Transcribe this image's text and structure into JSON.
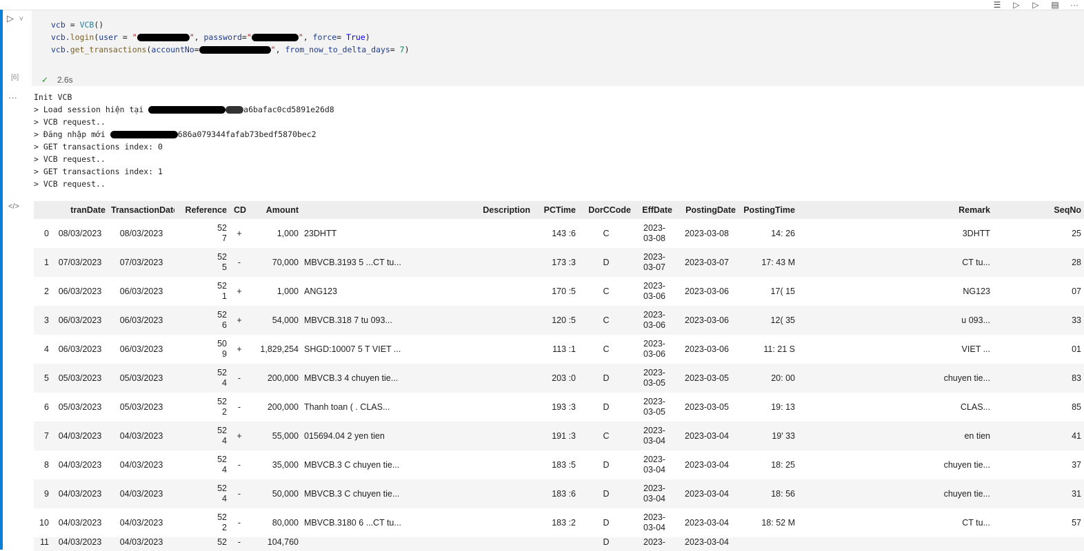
{
  "toolbar": {
    "icons": [
      "run-by-line-icon",
      "execute-above-icon",
      "execute-below-icon",
      "split-cell-icon",
      "more-icon"
    ],
    "more_label": "···"
  },
  "code_cell": {
    "run_glyph": "▷",
    "collapse_glyph": "˅",
    "execution_count": "[6]",
    "status_check": "✓",
    "execution_time": "2.6s",
    "lines": {
      "l1_var": "vcb",
      "l1_op": " = ",
      "l1_cls": "VCB",
      "l1_paren": "()",
      "l2_obj": "vcb.",
      "l2_fn": "login",
      "l2_open": "(",
      "l2_user_kw": "user",
      "l2_eq1": " = ",
      "l2_q1": "\"",
      "l2_q2": "\"",
      "l2_comma1": ", ",
      "l2_pass_kw": "password",
      "l2_eq2": "=",
      "l2_q3": "\"",
      "l2_q4": "\"",
      "l2_comma2": ", ",
      "l2_force_kw": "force",
      "l2_eq3": "= ",
      "l2_true": "True",
      "l2_close": ")",
      "l3_obj": "vcb.",
      "l3_fn": "get_transactions",
      "l3_open": "(",
      "l3_acc_kw": "accountNo",
      "l3_eq1": "=",
      "l3_q1": "\"",
      "l3_comma": ", ",
      "l3_days_kw": "from_now_to_delta_days",
      "l3_eq2": "= ",
      "l3_days": "7",
      "l3_close": ")"
    }
  },
  "output": {
    "more_glyph": "···",
    "html_glyph": "</>",
    "lines": {
      "o1": "Init VCB",
      "o2_pre": "> Load session hiện tại ",
      "o2_post": "a6bafac0cd5891e26d8",
      "o3": "> VCB request..",
      "o4_pre": "> Đăng nhập mới ",
      "o4_post": "686a079344fafab73bedf5870bec2",
      "o5": "> GET transactions index: 0",
      "o6": "> VCB request..",
      "o7": "> GET transactions index: 1",
      "o8": "> VCB request.."
    }
  },
  "table": {
    "columns": [
      "",
      "tranDate",
      "TransactionDate",
      "Reference",
      "CD",
      "Amount",
      "Description",
      "PCTime",
      "DorCCode",
      "EffDate",
      "PostingDate",
      "PostingTime",
      "Remark",
      "SeqNo"
    ],
    "rows": [
      {
        "idx": "0",
        "tranDate": "08/03/2023",
        "transactionDate": "08/03/2023",
        "reference": "52\n7",
        "cd": "+",
        "amount": "1,000",
        "description": "23DHTT",
        "pctime": "143 :6",
        "dorc": "C",
        "effdate": "2023-\n03-08",
        "postingdate": "2023-03-08",
        "postingtime": "14: 26",
        "remark": "3DHTT",
        "seqno": "25"
      },
      {
        "idx": "1",
        "tranDate": "07/03/2023",
        "transactionDate": "07/03/2023",
        "reference": "52\n5",
        "cd": "-",
        "amount": "70,000",
        "description": "MBVCB.3193 5   ...CT tu...",
        "pctime": "173 :3",
        "dorc": "D",
        "effdate": "2023-\n03-07",
        "postingdate": "2023-03-07",
        "postingtime": "17: 43  M",
        "remark": "CT tu...",
        "seqno": "28"
      },
      {
        "idx": "2",
        "tranDate": "06/03/2023",
        "transactionDate": "06/03/2023",
        "reference": "52\n1",
        "cd": "+",
        "amount": "1,000",
        "description": "ANG123",
        "pctime": "170 :5",
        "dorc": "C",
        "effdate": "2023-\n03-06",
        "postingdate": "2023-03-06",
        "postingtime": "17( 15",
        "remark": "NG123",
        "seqno": "07"
      },
      {
        "idx": "3",
        "tranDate": "06/03/2023",
        "transactionDate": "06/03/2023",
        "reference": "52\n6",
        "cd": "+",
        "amount": "54,000",
        "description": "MBVCB.318 7   tu 093...",
        "pctime": "120 :5",
        "dorc": "C",
        "effdate": "2023-\n03-06",
        "postingdate": "2023-03-06",
        "postingtime": "12( 35",
        "remark": "u 093...",
        "seqno": "33"
      },
      {
        "idx": "4",
        "tranDate": "06/03/2023",
        "transactionDate": "06/03/2023",
        "reference": "50\n9",
        "cd": "+",
        "amount": "1,829,254",
        "description": "SHGD:10007 5   T VIET ...",
        "pctime": "113 :1",
        "dorc": "C",
        "effdate": "2023-\n03-06",
        "postingdate": "2023-03-06",
        "postingtime": "11: 21  S",
        "remark": "VIET ...",
        "seqno": "01"
      },
      {
        "idx": "5",
        "tranDate": "05/03/2023",
        "transactionDate": "05/03/2023",
        "reference": "52\n4",
        "cd": "-",
        "amount": "200,000",
        "description": "MBVCB.3 4   chuyen tie...",
        "pctime": "203 :0",
        "dorc": "D",
        "effdate": "2023-\n03-05",
        "postingdate": "2023-03-05",
        "postingtime": "20: 00",
        "remark": "chuyen tie...",
        "seqno": "83"
      },
      {
        "idx": "6",
        "tranDate": "05/03/2023",
        "transactionDate": "05/03/2023",
        "reference": "52\n2",
        "cd": "-",
        "amount": "200,000",
        "description": "Thanh toan (   . CLAS...",
        "pctime": "193 :3",
        "dorc": "D",
        "effdate": "2023-\n03-05",
        "postingdate": "2023-03-05",
        "postingtime": "19: 13",
        "remark": "CLAS...",
        "seqno": "85"
      },
      {
        "idx": "7",
        "tranDate": "04/03/2023",
        "transactionDate": "04/03/2023",
        "reference": "52\n4",
        "cd": "+",
        "amount": "55,000",
        "description": "015694.04 2   yen tien",
        "pctime": "191 :3",
        "dorc": "C",
        "effdate": "2023-\n03-04",
        "postingdate": "2023-03-04",
        "postingtime": "19' 33",
        "remark": "en tien",
        "seqno": "41"
      },
      {
        "idx": "8",
        "tranDate": "04/03/2023",
        "transactionDate": "04/03/2023",
        "reference": "52\n4",
        "cd": "-",
        "amount": "35,000",
        "description": "MBVCB.3 C   chuyen tie...",
        "pctime": "183 :5",
        "dorc": "D",
        "effdate": "2023-\n03-04",
        "postingdate": "2023-03-04",
        "postingtime": "18: 25",
        "remark": "chuyen tie...",
        "seqno": "37"
      },
      {
        "idx": "9",
        "tranDate": "04/03/2023",
        "transactionDate": "04/03/2023",
        "reference": "52\n4",
        "cd": "-",
        "amount": "50,000",
        "description": "MBVCB.3 C   chuyen tie...",
        "pctime": "183 :6",
        "dorc": "D",
        "effdate": "2023-\n03-04",
        "postingdate": "2023-03-04",
        "postingtime": "18: 56",
        "remark": "chuyen tie...",
        "seqno": "31"
      },
      {
        "idx": "10",
        "tranDate": "04/03/2023",
        "transactionDate": "04/03/2023",
        "reference": "52\n2",
        "cd": "-",
        "amount": "80,000",
        "description": "MBVCB.3180 6   ...CT tu...",
        "pctime": "183 :2",
        "dorc": "D",
        "effdate": "2023-\n03-04",
        "postingdate": "2023-03-04",
        "postingtime": "18: 52  M",
        "remark": "CT tu...",
        "seqno": "57"
      },
      {
        "idx": "11",
        "tranDate": "04/03/2023",
        "transactionDate": "04/03/2023",
        "reference": "52",
        "cd": "-",
        "amount": "104,760",
        "description": "",
        "pctime": "",
        "dorc": "D",
        "effdate": "2023-",
        "postingdate": "2023-03-04",
        "postingtime": "",
        "remark": "",
        "seqno": ""
      }
    ]
  }
}
